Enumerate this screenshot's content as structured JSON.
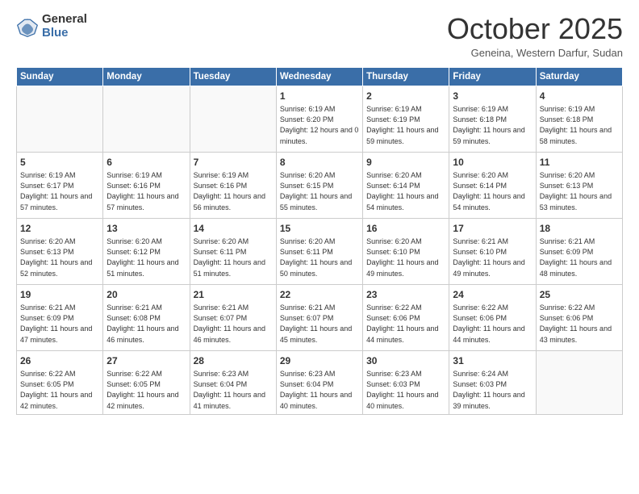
{
  "logo": {
    "general": "General",
    "blue": "Blue"
  },
  "header": {
    "month": "October 2025",
    "location": "Geneina, Western Darfur, Sudan"
  },
  "weekdays": [
    "Sunday",
    "Monday",
    "Tuesday",
    "Wednesday",
    "Thursday",
    "Friday",
    "Saturday"
  ],
  "weeks": [
    [
      {
        "day": "",
        "info": ""
      },
      {
        "day": "",
        "info": ""
      },
      {
        "day": "",
        "info": ""
      },
      {
        "day": "1",
        "info": "Sunrise: 6:19 AM\nSunset: 6:20 PM\nDaylight: 12 hours\nand 0 minutes."
      },
      {
        "day": "2",
        "info": "Sunrise: 6:19 AM\nSunset: 6:19 PM\nDaylight: 11 hours\nand 59 minutes."
      },
      {
        "day": "3",
        "info": "Sunrise: 6:19 AM\nSunset: 6:18 PM\nDaylight: 11 hours\nand 59 minutes."
      },
      {
        "day": "4",
        "info": "Sunrise: 6:19 AM\nSunset: 6:18 PM\nDaylight: 11 hours\nand 58 minutes."
      }
    ],
    [
      {
        "day": "5",
        "info": "Sunrise: 6:19 AM\nSunset: 6:17 PM\nDaylight: 11 hours\nand 57 minutes."
      },
      {
        "day": "6",
        "info": "Sunrise: 6:19 AM\nSunset: 6:16 PM\nDaylight: 11 hours\nand 57 minutes."
      },
      {
        "day": "7",
        "info": "Sunrise: 6:19 AM\nSunset: 6:16 PM\nDaylight: 11 hours\nand 56 minutes."
      },
      {
        "day": "8",
        "info": "Sunrise: 6:20 AM\nSunset: 6:15 PM\nDaylight: 11 hours\nand 55 minutes."
      },
      {
        "day": "9",
        "info": "Sunrise: 6:20 AM\nSunset: 6:14 PM\nDaylight: 11 hours\nand 54 minutes."
      },
      {
        "day": "10",
        "info": "Sunrise: 6:20 AM\nSunset: 6:14 PM\nDaylight: 11 hours\nand 54 minutes."
      },
      {
        "day": "11",
        "info": "Sunrise: 6:20 AM\nSunset: 6:13 PM\nDaylight: 11 hours\nand 53 minutes."
      }
    ],
    [
      {
        "day": "12",
        "info": "Sunrise: 6:20 AM\nSunset: 6:13 PM\nDaylight: 11 hours\nand 52 minutes."
      },
      {
        "day": "13",
        "info": "Sunrise: 6:20 AM\nSunset: 6:12 PM\nDaylight: 11 hours\nand 51 minutes."
      },
      {
        "day": "14",
        "info": "Sunrise: 6:20 AM\nSunset: 6:11 PM\nDaylight: 11 hours\nand 51 minutes."
      },
      {
        "day": "15",
        "info": "Sunrise: 6:20 AM\nSunset: 6:11 PM\nDaylight: 11 hours\nand 50 minutes."
      },
      {
        "day": "16",
        "info": "Sunrise: 6:20 AM\nSunset: 6:10 PM\nDaylight: 11 hours\nand 49 minutes."
      },
      {
        "day": "17",
        "info": "Sunrise: 6:21 AM\nSunset: 6:10 PM\nDaylight: 11 hours\nand 49 minutes."
      },
      {
        "day": "18",
        "info": "Sunrise: 6:21 AM\nSunset: 6:09 PM\nDaylight: 11 hours\nand 48 minutes."
      }
    ],
    [
      {
        "day": "19",
        "info": "Sunrise: 6:21 AM\nSunset: 6:09 PM\nDaylight: 11 hours\nand 47 minutes."
      },
      {
        "day": "20",
        "info": "Sunrise: 6:21 AM\nSunset: 6:08 PM\nDaylight: 11 hours\nand 46 minutes."
      },
      {
        "day": "21",
        "info": "Sunrise: 6:21 AM\nSunset: 6:07 PM\nDaylight: 11 hours\nand 46 minutes."
      },
      {
        "day": "22",
        "info": "Sunrise: 6:21 AM\nSunset: 6:07 PM\nDaylight: 11 hours\nand 45 minutes."
      },
      {
        "day": "23",
        "info": "Sunrise: 6:22 AM\nSunset: 6:06 PM\nDaylight: 11 hours\nand 44 minutes."
      },
      {
        "day": "24",
        "info": "Sunrise: 6:22 AM\nSunset: 6:06 PM\nDaylight: 11 hours\nand 44 minutes."
      },
      {
        "day": "25",
        "info": "Sunrise: 6:22 AM\nSunset: 6:06 PM\nDaylight: 11 hours\nand 43 minutes."
      }
    ],
    [
      {
        "day": "26",
        "info": "Sunrise: 6:22 AM\nSunset: 6:05 PM\nDaylight: 11 hours\nand 42 minutes."
      },
      {
        "day": "27",
        "info": "Sunrise: 6:22 AM\nSunset: 6:05 PM\nDaylight: 11 hours\nand 42 minutes."
      },
      {
        "day": "28",
        "info": "Sunrise: 6:23 AM\nSunset: 6:04 PM\nDaylight: 11 hours\nand 41 minutes."
      },
      {
        "day": "29",
        "info": "Sunrise: 6:23 AM\nSunset: 6:04 PM\nDaylight: 11 hours\nand 40 minutes."
      },
      {
        "day": "30",
        "info": "Sunrise: 6:23 AM\nSunset: 6:03 PM\nDaylight: 11 hours\nand 40 minutes."
      },
      {
        "day": "31",
        "info": "Sunrise: 6:24 AM\nSunset: 6:03 PM\nDaylight: 11 hours\nand 39 minutes."
      },
      {
        "day": "",
        "info": ""
      }
    ]
  ]
}
